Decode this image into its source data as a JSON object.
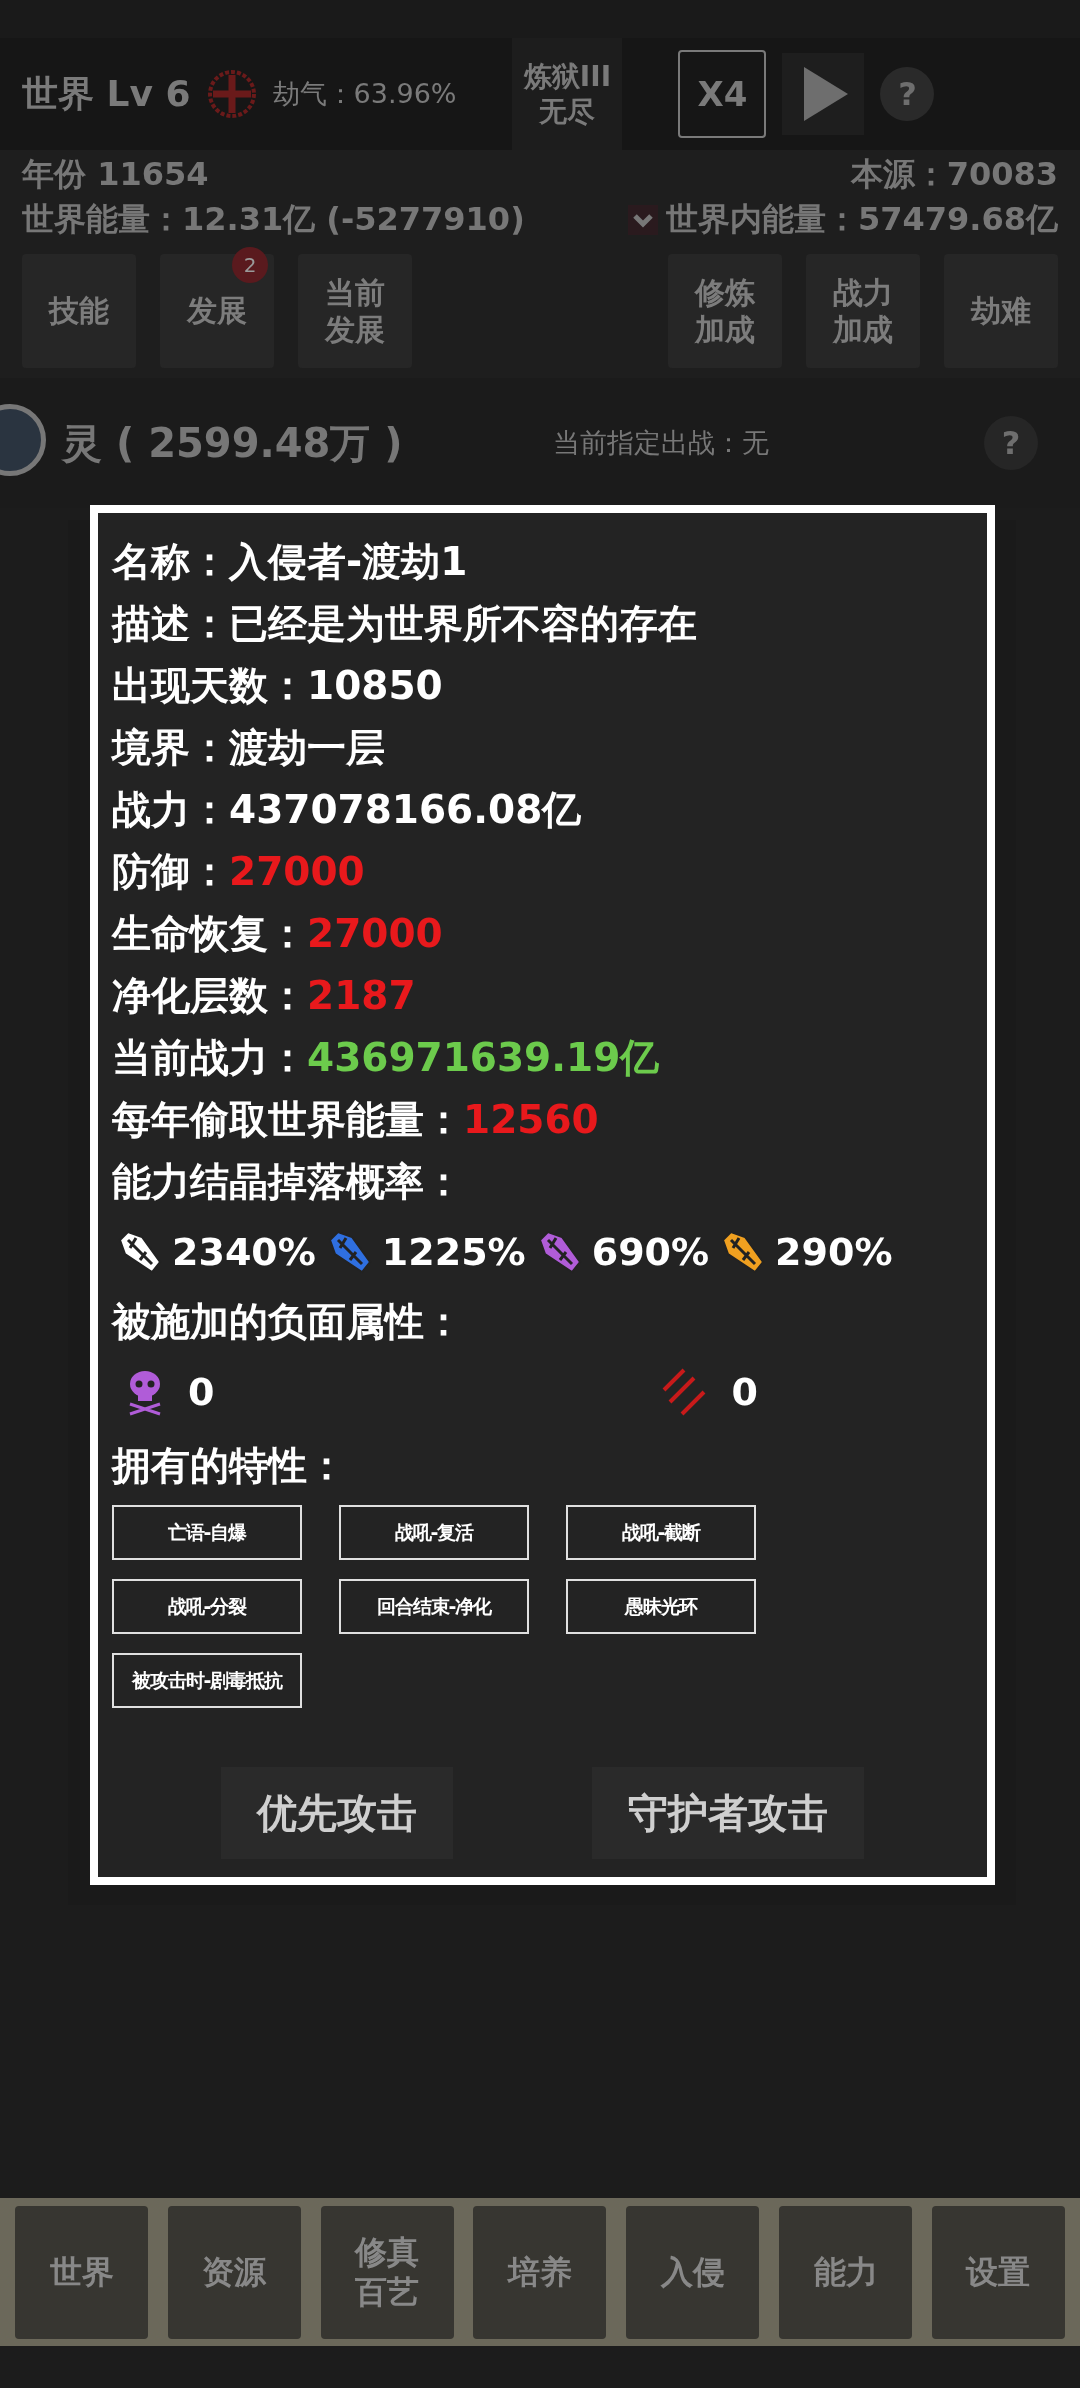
{
  "header": {
    "title": "世界 Lv 6",
    "jieqi": "劫气：63.96%",
    "mode": [
      "炼狱III",
      "无尽"
    ],
    "speed": "X4",
    "help": "?"
  },
  "info": {
    "year": "年份 11654",
    "source": "本源：70083",
    "energy": "世界能量：12.31亿 (-5277910)",
    "inner_energy": "世界内能量：57479.68亿"
  },
  "buttons": [
    {
      "lines": [
        "技能"
      ]
    },
    {
      "lines": [
        "发展"
      ],
      "badge": "2"
    },
    {
      "lines": [
        "当前",
        "发展"
      ]
    },
    {
      "lines": [
        "修炼",
        "加成"
      ]
    },
    {
      "lines": [
        "战力",
        "加成"
      ]
    },
    {
      "lines": [
        "劫难"
      ]
    }
  ],
  "section": {
    "title": "灵 ( 2599.48万 )",
    "assign": "当前指定出战：无",
    "help": "?"
  },
  "dialog": {
    "fields": [
      {
        "label": "名称：",
        "value": "入侵者-渡劫1",
        "color": "#ffffff"
      },
      {
        "label": "描述：",
        "value": "已经是为世界所不容的存在",
        "color": "#ffffff"
      },
      {
        "label": "出现天数：",
        "value": "10850",
        "color": "#ffffff"
      },
      {
        "label": "境界：",
        "value": "渡劫一层",
        "color": "#ffffff"
      },
      {
        "label": "战力：",
        "value": "437078166.08亿",
        "color": "#ffffff"
      },
      {
        "label": "防御：",
        "value": "27000",
        "color": "#e8191c"
      },
      {
        "label": "生命恢复：",
        "value": "27000",
        "color": "#e8191c"
      },
      {
        "label": "净化层数：",
        "value": "2187",
        "color": "#e8191c"
      },
      {
        "label": "当前战力：",
        "value": "436971639.19亿",
        "color": "#6ccb4c"
      },
      {
        "label": "每年偷取世界能量：",
        "value": "12560",
        "color": "#e8191c"
      }
    ],
    "drop_title": "能力结晶掉落概率：",
    "drops": [
      {
        "color": "#ffffff",
        "value": "2340%"
      },
      {
        "color": "#2f6fe0",
        "value": "1225%"
      },
      {
        "color": "#b05cd8",
        "value": "690%"
      },
      {
        "color": "#f0a020",
        "value": "290%"
      }
    ],
    "debuff_title": "被施加的负面属性：",
    "debuffs": [
      {
        "kind": "poison",
        "value": "0"
      },
      {
        "kind": "bleed",
        "value": "0"
      }
    ],
    "trait_title": "拥有的特性：",
    "traits": [
      "亡语-自爆",
      "战吼-复活",
      "战吼-截断",
      "战吼-分裂",
      "回合结束-净化",
      "愚昧光环",
      "被攻击时-剧毒抵抗"
    ],
    "actions": [
      "优先攻击",
      "守护者攻击"
    ]
  },
  "nav": [
    {
      "lines": [
        "世界"
      ]
    },
    {
      "lines": [
        "资源"
      ]
    },
    {
      "lines": [
        "修真",
        "百艺"
      ]
    },
    {
      "lines": [
        "培养"
      ]
    },
    {
      "lines": [
        "入侵"
      ]
    },
    {
      "lines": [
        "能力"
      ]
    },
    {
      "lines": [
        "设置"
      ]
    }
  ]
}
